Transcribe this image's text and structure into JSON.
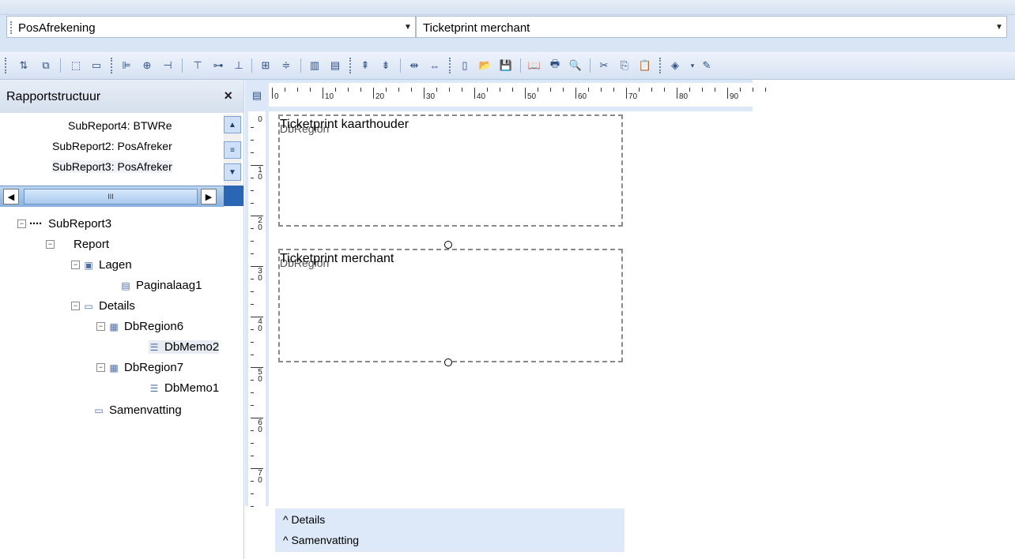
{
  "report_selector": {
    "value": "PosAfrekening"
  },
  "band_selector": {
    "value": "Ticketprint merchant"
  },
  "toolbar": {
    "icons": [
      "bring-forward-icon",
      "send-backward-icon",
      "grow-icon",
      "shrink-icon",
      "align-left-icon",
      "align-center-icon",
      "align-right-icon",
      "align-top-icon",
      "align-middle-icon",
      "align-bottom-icon",
      "space-horizontal-icon",
      "space-vertical-icon",
      "same-width-icon",
      "same-height-icon",
      "move-up-icon",
      "move-down-icon",
      "fit-width-icon",
      "fit-height-icon",
      "new-icon",
      "open-icon",
      "save-icon",
      "preview-icon",
      "print-icon",
      "print-preview-icon",
      "cut-icon",
      "copy-icon",
      "paste-icon",
      "fill-color-icon",
      "line-color-icon"
    ]
  },
  "panel": {
    "title": "Rapportstructuur",
    "close": "×",
    "upper_items": [
      "SubReport4: BTWRe",
      "SubReport2: PosAfreker",
      "SubReport3: PosAfreker"
    ],
    "hscroll_thumb": "III"
  },
  "tree": [
    {
      "label": "SubReport3",
      "icon": "dots-icon",
      "level": 0,
      "expander": "−"
    },
    {
      "label": "Report",
      "icon": "",
      "level": 1,
      "expander": "−"
    },
    {
      "label": "Lagen",
      "icon": "layers-icon",
      "level": 2,
      "expander": "−"
    },
    {
      "label": "Paginalaag1",
      "icon": "page-icon",
      "level": 3,
      "expander": ""
    },
    {
      "label": "Details",
      "icon": "band-icon",
      "level": 2,
      "expander": "−"
    },
    {
      "label": "DbRegion6",
      "icon": "region-icon",
      "level": 3,
      "expander": "−"
    },
    {
      "label": "DbMemo2",
      "icon": "memo-icon",
      "level": 4,
      "expander": ""
    },
    {
      "label": "DbRegion7",
      "icon": "region-icon",
      "level": 3,
      "expander": "−"
    },
    {
      "label": "DbMemo1",
      "icon": "memo-icon",
      "level": 4,
      "expander": ""
    },
    {
      "label": "Samenvatting",
      "icon": "band-icon",
      "level": 2,
      "expander": ""
    }
  ],
  "ruler_h": {
    "labels": [
      "0",
      "10",
      "20",
      "30",
      "40",
      "50",
      "60",
      "70",
      "80",
      "90"
    ]
  },
  "ruler_v": {
    "labels": [
      "0",
      "1\n0",
      "2\n0",
      "3\n0",
      "4\n0",
      "5\n0",
      "6\n0",
      "7\n0"
    ]
  },
  "canvas": {
    "region1": {
      "text": "Ticketprint kaarthouder",
      "overlay": "DbRegion"
    },
    "region2": {
      "text": "Ticketprint merchant",
      "overlay": "DbRegion"
    }
  },
  "bands": [
    "^ Details",
    "^ Samenvatting"
  ]
}
